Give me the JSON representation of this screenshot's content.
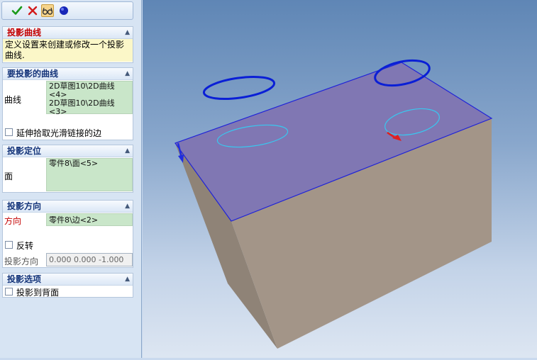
{
  "toolbar": {
    "ok_icon": "check-icon",
    "cancel_icon": "close-icon",
    "preview_icon": "glasses-icon",
    "option_icon": "circle-icon"
  },
  "header": {
    "title": "投影曲线",
    "description": "定义设置来创建或修改一个投影曲线."
  },
  "curves_section": {
    "title": "要投影的曲线",
    "label": "曲线",
    "items": [
      "2D草图10\\2D曲线<4>",
      "2D草图10\\2D曲线<3>"
    ],
    "extend_checkbox": "延伸拾取光滑链接的边",
    "extend_checked": false
  },
  "location_section": {
    "title": "投影定位",
    "label": "面",
    "value": "零件8\\面<5>"
  },
  "direction_section": {
    "title": "投影方向",
    "label": "方向",
    "value": "零件8\\边<2>",
    "reverse_checkbox": "反转",
    "reverse_checked": false,
    "vector_label": "投影方向",
    "vector_value": "0.000  0.000  -1.000"
  },
  "options_section": {
    "title": "投影选项",
    "back_checkbox": "投影到背面",
    "back_checked": false
  },
  "colors": {
    "panel_bg": "#d7e4f3",
    "list_green": "#c9e6c9",
    "title_red": "#c40000",
    "face_top": "#8078b2",
    "face_side": "#a09386",
    "curve_blue": "#0a1fd6",
    "projected_cyan": "#38c8f0",
    "arrow_red": "#e02020"
  }
}
